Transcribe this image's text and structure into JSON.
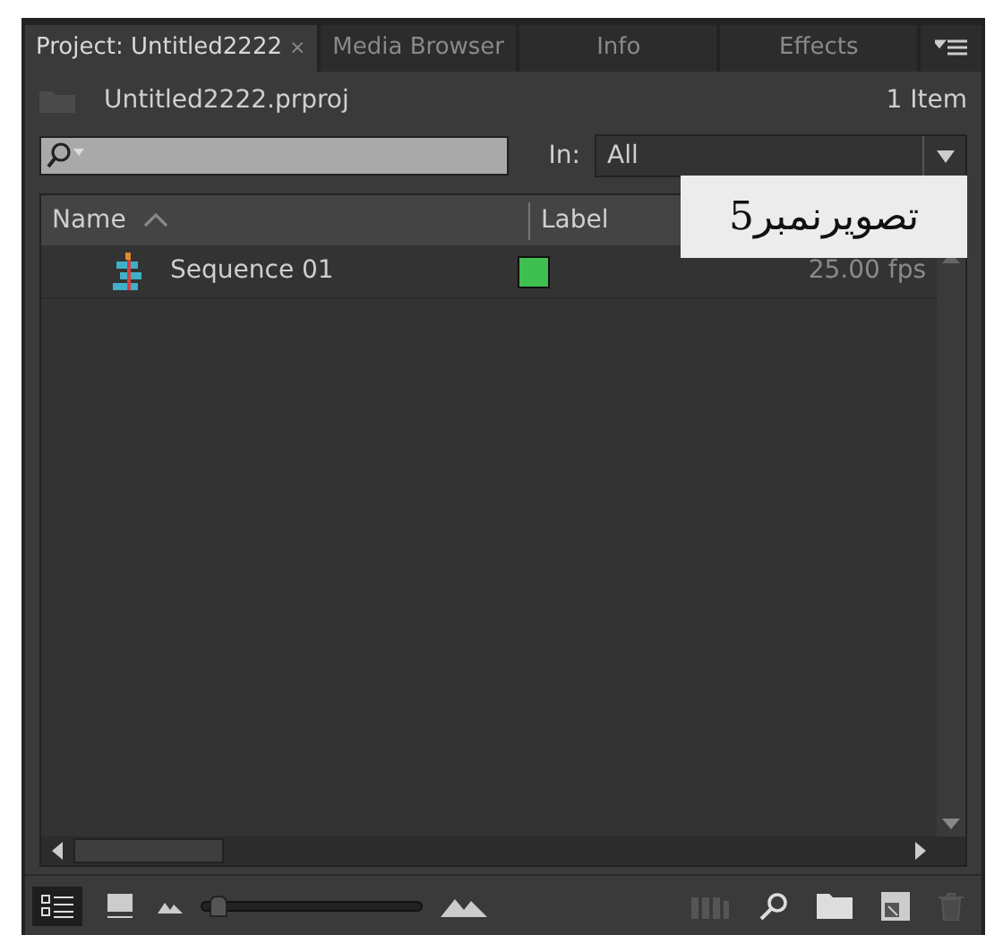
{
  "tabs": [
    {
      "label": "Project: Untitled2222",
      "close": "×",
      "selected": true
    },
    {
      "label": "Media Browser",
      "selected": false
    },
    {
      "label": "Info",
      "selected": false
    },
    {
      "label": "Effects",
      "selected": false
    }
  ],
  "project": {
    "file": "Untitled2222.prproj",
    "count": "1 Item"
  },
  "search": {
    "in_label": "In:",
    "in_value": "All"
  },
  "table": {
    "columns": [
      "Name",
      "Label"
    ],
    "rows": [
      {
        "name": "Sequence 01",
        "color": "#3fbf4f",
        "column_3": "25.00 fps"
      }
    ]
  },
  "caption": "تصویرنمبر5",
  "footer": {
    "list_view_selected": true,
    "zoom": {
      "level": 0.04
    },
    "automate_disabled": true,
    "delete_disabled": true
  }
}
